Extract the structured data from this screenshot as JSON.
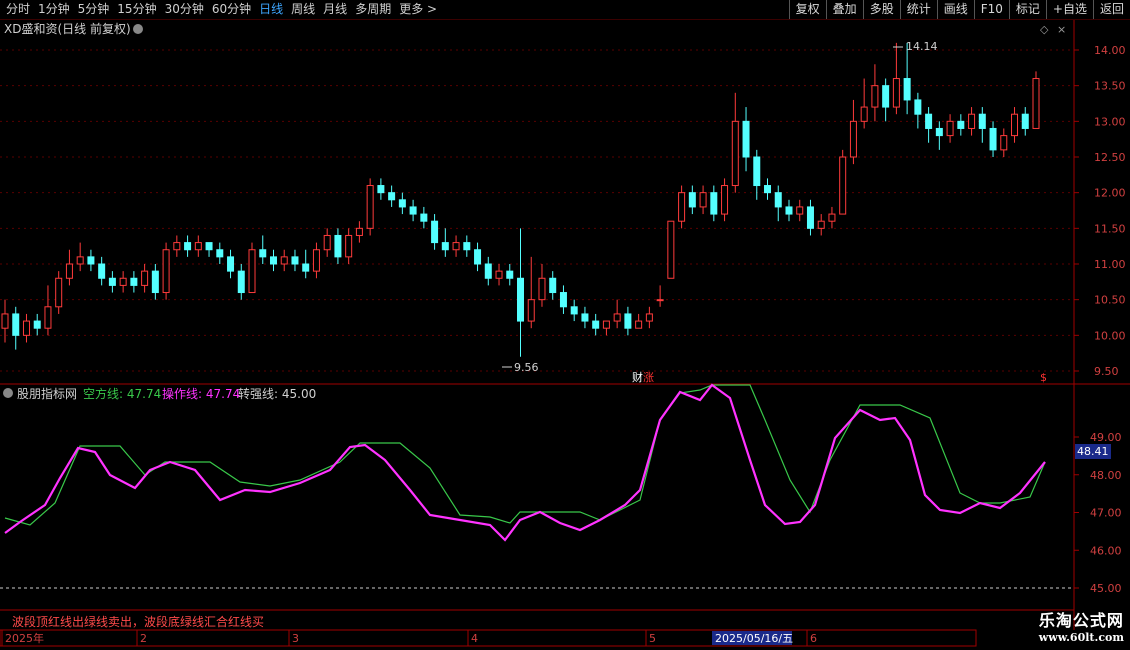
{
  "toolbar": {
    "periods": [
      "分时",
      "1分钟",
      "5分钟",
      "15分钟",
      "30分钟",
      "60分钟",
      "日线",
      "周线",
      "月线",
      "多周期",
      "更多 >"
    ],
    "active_period": "日线",
    "actions": [
      "复权",
      "叠加",
      "多股",
      "统计",
      "画线",
      "F10",
      "+自选",
      "返回"
    ],
    "extra": "标记"
  },
  "main_panel": {
    "title": "XD盛和资(日线 前复权)",
    "price_axis": [
      "14.00",
      "13.50",
      "13.00",
      "12.50",
      "12.00",
      "11.50",
      "11.00",
      "10.50",
      "10.00",
      "9.50"
    ],
    "high_label": "14.14",
    "low_label": "9.56",
    "marker_text": "财",
    "marker_text2": "涨",
    "right_marker": "$"
  },
  "indicator_panel": {
    "name": "股朋指标网",
    "line1_label": "空方线: 47.74",
    "line2_label": "操作线: 47.74",
    "line3_label": "转强线: 45.00",
    "axis": [
      "49.00",
      "48.00",
      "47.00",
      "46.00",
      "45.00"
    ],
    "current_value": "48.41",
    "note": "波段顶红线出绿线卖出，波段底绿线汇合红线买"
  },
  "date_axis": {
    "labels": [
      "2025年",
      "2",
      "3",
      "4",
      "5",
      "2025/05/16/五",
      "6"
    ]
  },
  "brand": {
    "name": "乐淘公式网",
    "url": "www.60lt.com"
  },
  "chart_data": {
    "type": "candlestick",
    "candles": [
      [
        10.1,
        10.3,
        9.9,
        10.5
      ],
      [
        10.3,
        10.0,
        9.8,
        10.4
      ],
      [
        10.0,
        10.2,
        9.9,
        10.3
      ],
      [
        10.2,
        10.1,
        10.0,
        10.3
      ],
      [
        10.1,
        10.4,
        10.0,
        10.7
      ],
      [
        10.4,
        10.8,
        10.3,
        10.9
      ],
      [
        10.8,
        11.0,
        10.7,
        11.2
      ],
      [
        11.0,
        11.1,
        10.9,
        11.3
      ],
      [
        11.1,
        11.0,
        10.9,
        11.2
      ],
      [
        11.0,
        10.8,
        10.7,
        11.1
      ],
      [
        10.8,
        10.7,
        10.6,
        10.9
      ],
      [
        10.7,
        10.8,
        10.6,
        10.9
      ],
      [
        10.8,
        10.7,
        10.6,
        10.9
      ],
      [
        10.7,
        10.9,
        10.6,
        11.0
      ],
      [
        10.9,
        10.6,
        10.5,
        11.0
      ],
      [
        10.6,
        11.2,
        10.5,
        11.3
      ],
      [
        11.2,
        11.3,
        11.1,
        11.4
      ],
      [
        11.3,
        11.2,
        11.1,
        11.4
      ],
      [
        11.2,
        11.3,
        11.1,
        11.4
      ],
      [
        11.3,
        11.2,
        11.1,
        11.3
      ],
      [
        11.2,
        11.1,
        11.0,
        11.3
      ],
      [
        11.1,
        10.9,
        10.8,
        11.2
      ],
      [
        10.9,
        10.6,
        10.5,
        11.0
      ],
      [
        10.6,
        11.2,
        10.6,
        11.3
      ],
      [
        11.2,
        11.1,
        11.0,
        11.4
      ],
      [
        11.1,
        11.0,
        10.9,
        11.2
      ],
      [
        11.0,
        11.1,
        10.9,
        11.2
      ],
      [
        11.1,
        11.0,
        10.9,
        11.2
      ],
      [
        11.0,
        10.9,
        10.8,
        11.2
      ],
      [
        10.9,
        11.2,
        10.8,
        11.3
      ],
      [
        11.2,
        11.4,
        11.1,
        11.5
      ],
      [
        11.4,
        11.1,
        11.0,
        11.5
      ],
      [
        11.1,
        11.4,
        11.0,
        11.5
      ],
      [
        11.4,
        11.5,
        11.3,
        11.6
      ],
      [
        11.5,
        12.1,
        11.4,
        12.2
      ],
      [
        12.1,
        12.0,
        11.9,
        12.2
      ],
      [
        12.0,
        11.9,
        11.8,
        12.1
      ],
      [
        11.9,
        11.8,
        11.7,
        12.0
      ],
      [
        11.8,
        11.7,
        11.6,
        11.9
      ],
      [
        11.7,
        11.6,
        11.5,
        11.8
      ],
      [
        11.6,
        11.3,
        11.2,
        11.7
      ],
      [
        11.3,
        11.2,
        11.1,
        11.5
      ],
      [
        11.2,
        11.3,
        11.1,
        11.4
      ],
      [
        11.3,
        11.2,
        11.1,
        11.4
      ],
      [
        11.2,
        11.0,
        10.9,
        11.3
      ],
      [
        11.0,
        10.8,
        10.7,
        11.1
      ],
      [
        10.8,
        10.9,
        10.7,
        11.0
      ],
      [
        10.9,
        10.8,
        10.7,
        11.0
      ],
      [
        10.8,
        10.2,
        9.7,
        11.5
      ],
      [
        10.2,
        10.5,
        10.1,
        11.1
      ],
      [
        10.5,
        10.8,
        10.4,
        11.0
      ],
      [
        10.8,
        10.6,
        10.5,
        10.9
      ],
      [
        10.6,
        10.4,
        10.3,
        10.7
      ],
      [
        10.4,
        10.3,
        10.2,
        10.5
      ],
      [
        10.3,
        10.2,
        10.1,
        10.4
      ],
      [
        10.2,
        10.1,
        10.0,
        10.3
      ],
      [
        10.1,
        10.2,
        10.0,
        10.2
      ],
      [
        10.2,
        10.3,
        10.1,
        10.5
      ],
      [
        10.3,
        10.1,
        10.0,
        10.4
      ],
      [
        10.1,
        10.2,
        10.1,
        10.3
      ],
      [
        10.2,
        10.3,
        10.1,
        10.4
      ],
      [
        10.5,
        10.5,
        10.4,
        10.7
      ],
      [
        10.8,
        11.6,
        10.8,
        11.6
      ],
      [
        11.6,
        12.0,
        11.5,
        12.1
      ],
      [
        12.0,
        11.8,
        11.7,
        12.1
      ],
      [
        11.8,
        12.0,
        11.7,
        12.1
      ],
      [
        12.0,
        11.7,
        11.6,
        12.1
      ],
      [
        11.7,
        12.1,
        11.6,
        12.2
      ],
      [
        12.1,
        13.0,
        12.0,
        13.4
      ],
      [
        13.0,
        12.5,
        12.3,
        13.2
      ],
      [
        12.5,
        12.1,
        11.9,
        12.6
      ],
      [
        12.1,
        12.0,
        11.9,
        12.2
      ],
      [
        12.0,
        11.8,
        11.6,
        12.1
      ],
      [
        11.8,
        11.7,
        11.6,
        11.9
      ],
      [
        11.7,
        11.8,
        11.6,
        11.9
      ],
      [
        11.8,
        11.5,
        11.4,
        11.9
      ],
      [
        11.5,
        11.6,
        11.4,
        11.7
      ],
      [
        11.6,
        11.7,
        11.5,
        11.8
      ],
      [
        11.7,
        12.5,
        11.7,
        12.6
      ],
      [
        12.5,
        13.0,
        12.4,
        13.3
      ],
      [
        13.0,
        13.2,
        12.9,
        13.6
      ],
      [
        13.2,
        13.5,
        13.0,
        13.8
      ],
      [
        13.5,
        13.2,
        13.0,
        13.6
      ],
      [
        13.2,
        13.6,
        13.1,
        14.1
      ],
      [
        13.6,
        13.3,
        13.1,
        14.1
      ],
      [
        13.3,
        13.1,
        12.9,
        13.4
      ],
      [
        13.1,
        12.9,
        12.7,
        13.2
      ],
      [
        12.9,
        12.8,
        12.6,
        13.0
      ],
      [
        12.8,
        13.0,
        12.7,
        13.1
      ],
      [
        13.0,
        12.9,
        12.8,
        13.1
      ],
      [
        12.9,
        13.1,
        12.8,
        13.2
      ],
      [
        13.1,
        12.9,
        12.7,
        13.2
      ],
      [
        12.9,
        12.6,
        12.5,
        13.0
      ],
      [
        12.6,
        12.8,
        12.5,
        12.9
      ],
      [
        12.8,
        13.1,
        12.7,
        13.2
      ],
      [
        13.1,
        12.9,
        12.8,
        13.2
      ],
      [
        12.9,
        13.6,
        12.9,
        13.7
      ]
    ],
    "series": [
      {
        "name": "空方线",
        "color": "#39c84a"
      },
      {
        "name": "操作线",
        "color": "#ff33ff"
      }
    ]
  }
}
